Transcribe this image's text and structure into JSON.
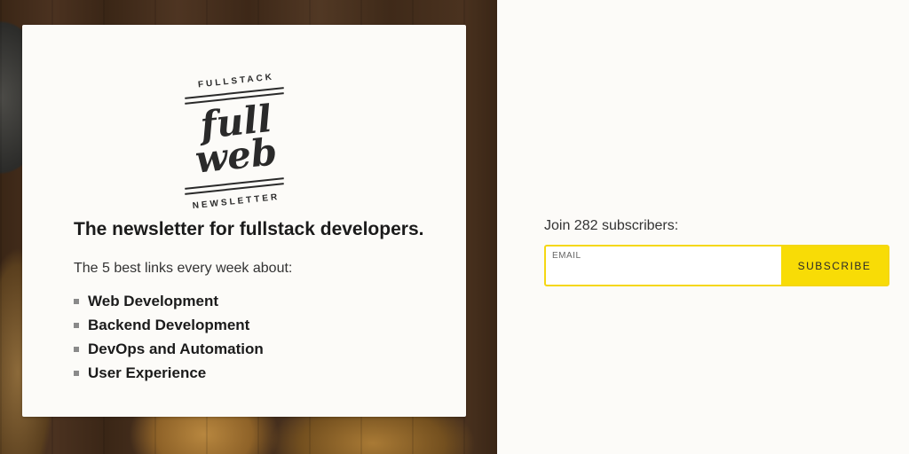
{
  "logo": {
    "top_text": "FULLSTACK",
    "word1": "full",
    "word2": "web",
    "bottom_text": "NEWSLETTER"
  },
  "card": {
    "headline": "The newsletter for fullstack developers.",
    "subtitle": "The 5 best links every week about:",
    "topics": [
      "Web Development",
      "Backend Development",
      "DevOps and Automation",
      "User Experience"
    ]
  },
  "signup": {
    "join_text": "Join 282 subscribers:",
    "email_label": "EMAIL",
    "email_value": "",
    "subscribe_label": "SUBSCRIBE"
  },
  "colors": {
    "accent": "#f8dc06",
    "background": "#fcfbf8"
  }
}
